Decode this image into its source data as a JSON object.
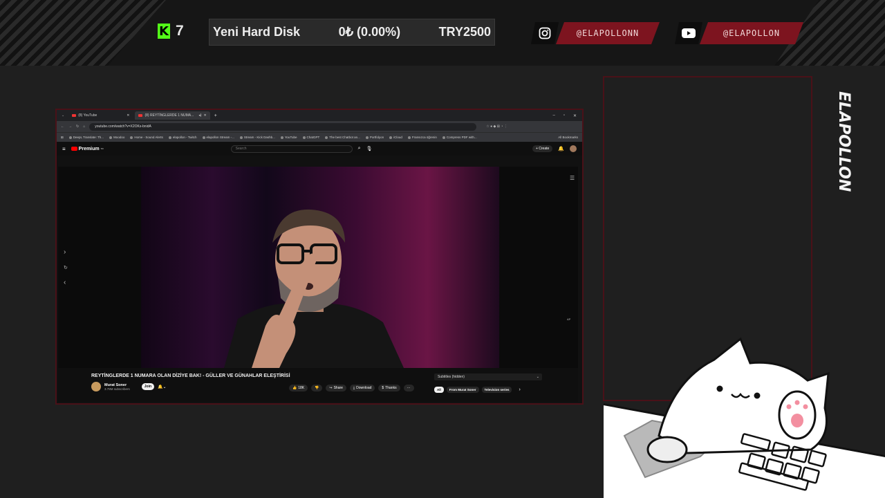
{
  "overlay": {
    "kick_viewers": "7",
    "goal": {
      "label": "Yeni Hard Disk",
      "progress": "0₺ (0.00%)",
      "target": "TRY2500",
      "progress_fraction": 0.0
    },
    "instagram_handle": "@ELAPOLLONN",
    "youtube_handle": "@ELAPOLLON",
    "vertical_name": "ELAPOLLON",
    "accent_color": "#7d141f",
    "kick_color": "#53fc18"
  },
  "browser": {
    "tabs": [
      {
        "label": "(8) YouTube",
        "active": false
      },
      {
        "label": "(8) REYTİNGLERDE 1 NUMA...",
        "active": true
      }
    ],
    "new_tab": "+",
    "url": "youtube.com/watch?v=X2OKs-bnidA",
    "bookmarks": [
      "DeepL Translate: Th...",
      "Moodoo",
      "Home - Sound Alerts",
      "elapollon - Twitch",
      "elapollon Stream -...",
      "Stream - Kick Dashb...",
      "YouTube",
      "ChatGPT",
      "The best Chatbot an...",
      "Portfolyon",
      "iCloud",
      "Fransızca öğrenin",
      "Compress PDF with..."
    ],
    "all_bookmarks": "All Bookmarks"
  },
  "youtube": {
    "logo_text": "Premium",
    "logo_sup": "TR",
    "search_placeholder": "Search",
    "create_label": "Create",
    "video_title": "REYTİNGLERDE 1 NUMARA OLAN DİZİYE BAK! - GÜLLER VE GÜNAHLAR ELEŞTİRİSİ",
    "channel_name": "Murat Soner",
    "subscribers": "3.78M subscribers",
    "join_label": "Join",
    "likes": "18K",
    "share_label": "Share",
    "download_label": "Download",
    "thanks_label": "Thanks",
    "more_label": "···",
    "subtitles_label": "Subtitles (hidden)",
    "chips": [
      "All",
      "From Murat Soner",
      "Television series"
    ],
    "autoplay_label": "AP"
  }
}
